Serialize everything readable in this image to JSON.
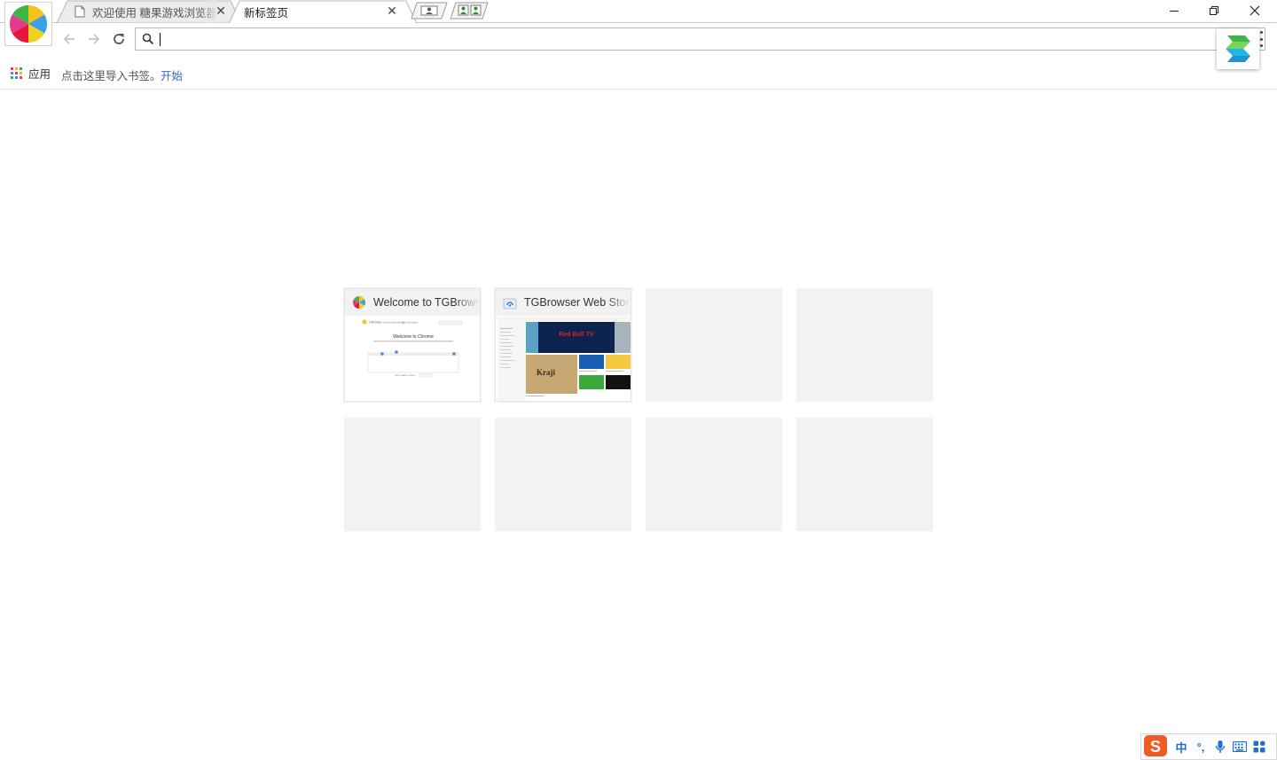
{
  "tabs": [
    {
      "title": "欢迎使用 糖果游戏浏览器",
      "close": "✕"
    },
    {
      "title": "新标签页",
      "close": "✕"
    }
  ],
  "window_controls": {
    "minimize": "—",
    "restore": "❐",
    "close": "✕"
  },
  "omnibox": {
    "value": "",
    "placeholder": ""
  },
  "bookmarks": {
    "apps_label": "应用",
    "import_text": "点击这里导入书签。",
    "import_link": "开始"
  },
  "tiles": [
    {
      "title": "Welcome to TGBrowser",
      "thumb_heading": "Welcome to Chrome",
      "thumb_search": "Just search away",
      "thumb_nav": [
        "Chrome",
        "Overview",
        "Download",
        "Beta",
        "Browser"
      ]
    },
    {
      "title": "TGBrowser Web Store",
      "thumb_banner": "Red Bull TV",
      "thumb_logo": "Kraji"
    },
    {
      "title": ""
    },
    {
      "title": ""
    },
    {
      "title": ""
    },
    {
      "title": ""
    },
    {
      "title": ""
    },
    {
      "title": ""
    }
  ],
  "ime": {
    "mode": "中",
    "punct": "°,"
  },
  "colors": {
    "accent_link": "#3367d6",
    "tile_bg": "#f2f2f2",
    "ime_orange": "#f15a24",
    "ime_blue": "#1a6fd1"
  },
  "icons": [
    "app-logo-icon",
    "document-icon",
    "back-arrow-icon",
    "forward-arrow-icon",
    "reload-icon",
    "search-icon",
    "menu-dots-icon",
    "extension-icon",
    "apps-grid-icon",
    "profile-icon",
    "microphone-icon",
    "keyboard-icon",
    "grid-icon"
  ]
}
